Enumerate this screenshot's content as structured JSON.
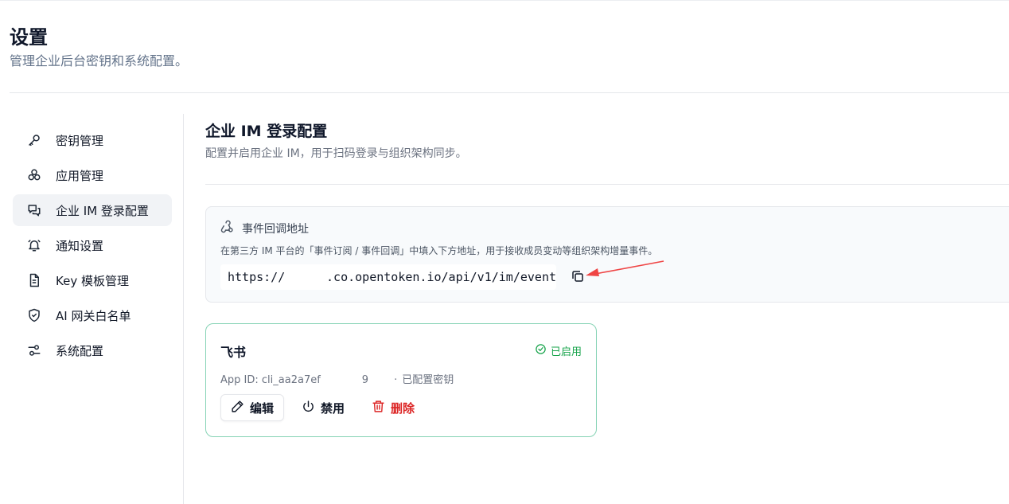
{
  "page": {
    "title": "设置",
    "subtitle": "管理企业后台密钥和系统配置。"
  },
  "sidebar": {
    "items": [
      {
        "label": "密钥管理",
        "icon": "key-icon",
        "active": false
      },
      {
        "label": "应用管理",
        "icon": "apps-icon",
        "active": false
      },
      {
        "label": "企业 IM 登录配置",
        "icon": "chat-icon",
        "active": true
      },
      {
        "label": "通知设置",
        "icon": "bell-icon",
        "active": false
      },
      {
        "label": "Key 模板管理",
        "icon": "document-icon",
        "active": false
      },
      {
        "label": "AI 网关白名单",
        "icon": "shield-icon",
        "active": false
      },
      {
        "label": "系统配置",
        "icon": "sliders-icon",
        "active": false
      }
    ]
  },
  "main": {
    "title": "企业 IM 登录配置",
    "description": "配置并启用企业 IM，用于扫码登录与组织架构同步。",
    "callback": {
      "title": "事件回调地址",
      "icon": "webhook-icon",
      "description": "在第三方 IM 平台的「事件订阅 / 事件回调」中填入下方地址，用于接收成员变动等组织架构增量事件。",
      "url_prefix": "https://",
      "url_suffix": ".co.opentoken.io/api/v1/im/event",
      "copy_icon": "copy-icon"
    },
    "provider": {
      "name": "飞书",
      "status": "已启用",
      "status_color": "#16a34a",
      "app_id_label": "App ID:",
      "app_id_value": "cli_aa2a7ef",
      "app_id_fragment": "9",
      "secret_status": "已配置密钥",
      "actions": {
        "edit": "编辑",
        "disable": "禁用",
        "delete": "删除"
      },
      "delete_color": "#dc2626"
    }
  },
  "colors": {
    "card_border": "#86d3b5",
    "annotation_arrow": "#ef4444",
    "active_nav_bg": "#f1f3f6"
  }
}
